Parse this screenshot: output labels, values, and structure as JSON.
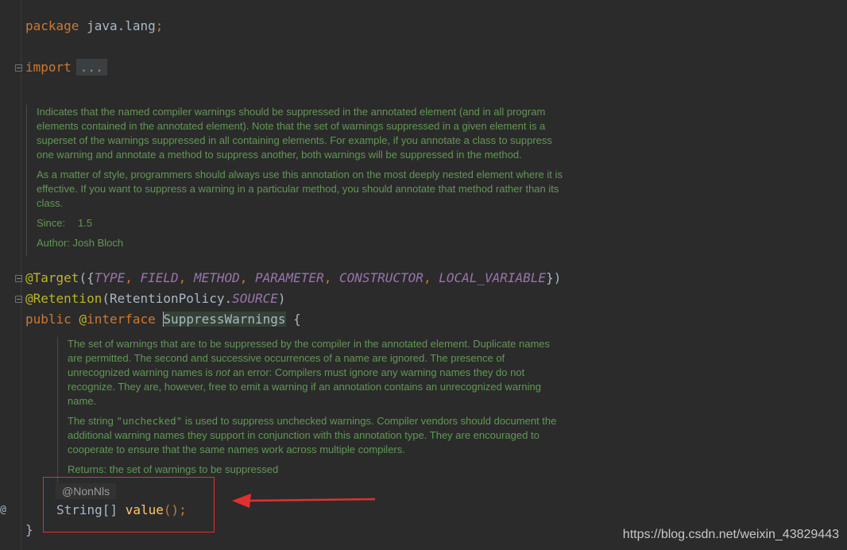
{
  "editor": {
    "package_line": {
      "kw": "package",
      "name": "java.lang",
      "semi": ";"
    },
    "import_line": {
      "kw": "import",
      "ellipsis": "..."
    },
    "class_doc": {
      "para1": "Indicates that the named compiler warnings should be suppressed in the annotated element (and in all program elements contained in the annotated element). Note that the set of warnings suppressed in a given element is a superset of the warnings suppressed in all containing elements. For example, if you annotate a class to suppress one warning and annotate a method to suppress another, both warnings will be suppressed in the method.",
      "para2": "As a matter of style, programmers should always use this annotation on the most deeply nested element where it is effective. If you want to suppress a warning in a particular method, you should annotate that method rather than its class.",
      "since_label": "Since:",
      "since_value": "1.5",
      "author_label": "Author:",
      "author_value": "Josh Bloch"
    },
    "target_line": {
      "ann": "@Target",
      "open": "({",
      "items": [
        "TYPE",
        "FIELD",
        "METHOD",
        "PARAMETER",
        "CONSTRUCTOR",
        "LOCAL_VARIABLE"
      ],
      "close": "})"
    },
    "retention_line": {
      "ann": "@Retention",
      "open": "(RetentionPolicy.",
      "value": "SOURCE",
      "close": ")"
    },
    "interface_line": {
      "kw1": "public",
      "at": "@",
      "kw2": "interface",
      "name": "SuppressWarnings",
      "brace": " {"
    },
    "method_doc": {
      "para1_a": "The set of warnings that are to be suppressed by the compiler in the annotated element. Duplicate names are permitted. The second and successive occurrences of a name are ignored. The presence of unrecognized warning names is ",
      "para1_em": "not",
      "para1_b": " an error: Compilers must ignore any warning names they do not recognize. They are, however, free to emit a warning if an annotation contains an unrecognized warning name.",
      "para2_a": "The string ",
      "para2_code": "\"unchecked\"",
      "para2_b": " is used to suppress unchecked warnings. Compiler vendors should document the additional warning names they support in conjunction with this annotation type. They are encouraged to cooperate to ensure that the same names work across multiple compilers.",
      "returns_label": "Returns:",
      "returns_value": "the set of warnings to be suppressed"
    },
    "nonnls": "@NonNls",
    "method_line": {
      "type": "String[] ",
      "name": "value",
      "rest": "();"
    },
    "closing_brace": "}",
    "gutter_at": "@"
  },
  "watermark": "https://blog.csdn.net/weixin_43829443",
  "colors": {
    "background": "#2b2b2b",
    "keyword": "#cc7832",
    "annotation": "#bbb529",
    "doc": "#629755",
    "constant": "#9876aa",
    "highlight_box": "#e03030"
  }
}
